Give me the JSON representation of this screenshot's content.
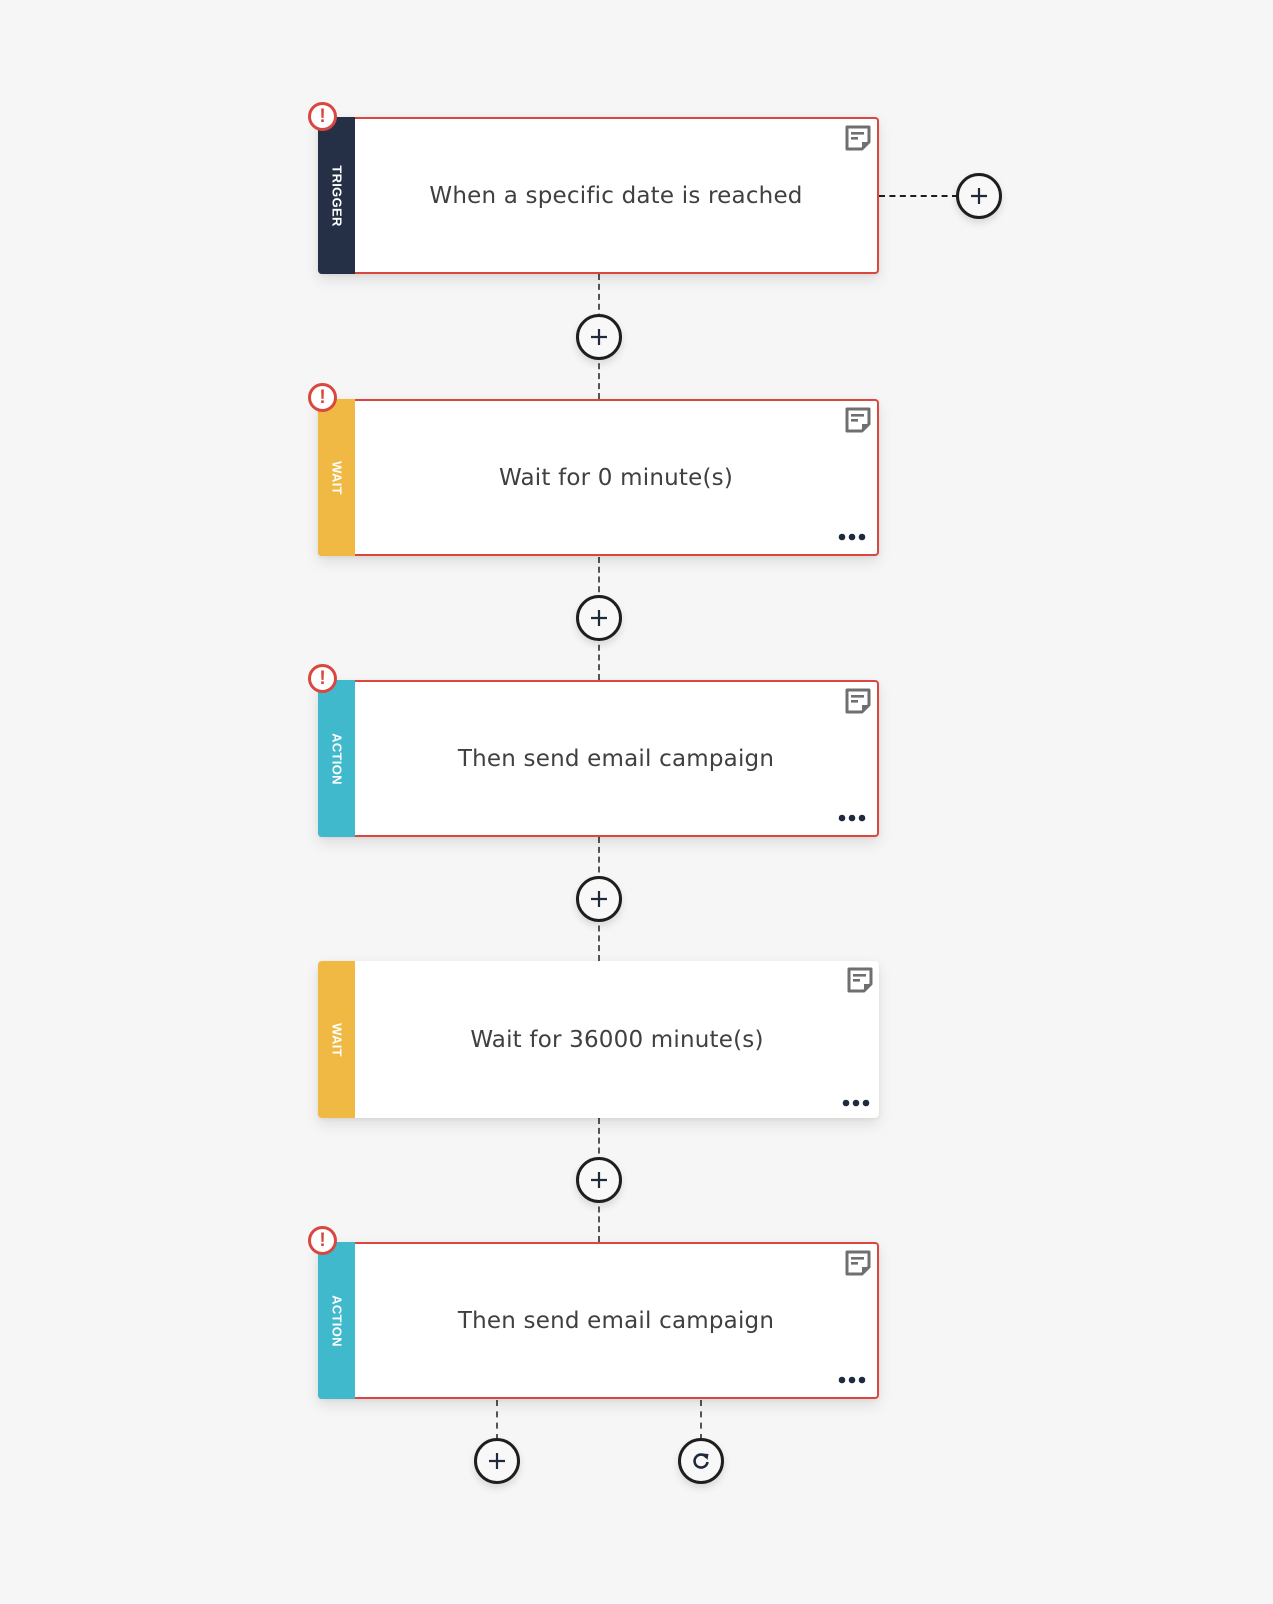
{
  "workflow": {
    "nodes": [
      {
        "type_label": "TRIGGER",
        "kind": "trigger",
        "title": "When a specific date is reached",
        "has_error": true,
        "has_menu": false,
        "icons": [
          "note-icon"
        ]
      },
      {
        "type_label": "WAIT",
        "kind": "wait",
        "title": "Wait for 0 minute(s)",
        "has_error": true,
        "has_menu": true,
        "icons": [
          "note-icon",
          "more-icon"
        ]
      },
      {
        "type_label": "ACTION",
        "kind": "action",
        "title": "Then send email campaign",
        "has_error": true,
        "has_menu": true,
        "icons": [
          "note-icon",
          "more-icon"
        ]
      },
      {
        "type_label": "WAIT",
        "kind": "wait",
        "title": "Wait for 36000 minute(s)",
        "has_error": false,
        "has_menu": true,
        "icons": [
          "note-icon",
          "more-icon"
        ]
      },
      {
        "type_label": "ACTION",
        "kind": "action",
        "title": "Then send email campaign",
        "has_error": true,
        "has_menu": true,
        "icons": [
          "note-icon",
          "more-icon"
        ]
      }
    ],
    "error_badge_glyph": "!",
    "add_step_icon": "plus-icon",
    "loop_icon": "refresh-icon",
    "colors": {
      "background": "#f6f6f6",
      "error": "#d9473f",
      "trigger": "#253046",
      "wait": "#efb943",
      "action": "#41b9cc",
      "text": "#404040",
      "icon": "#1e1e1e"
    }
  }
}
